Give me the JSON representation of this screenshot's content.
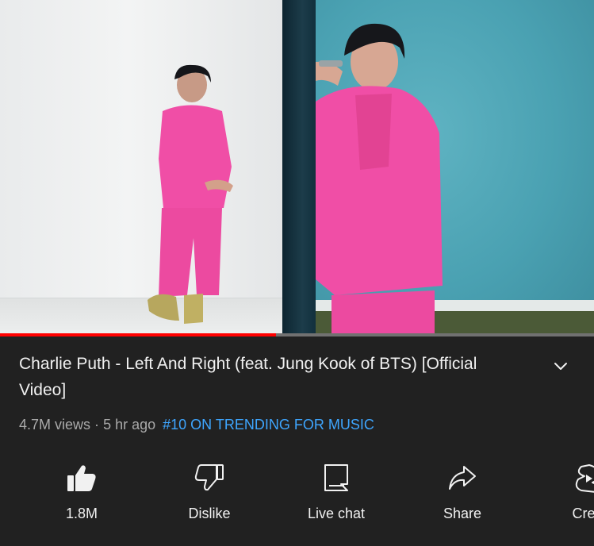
{
  "video": {
    "progress_percent": 46.5
  },
  "info": {
    "title": "Charlie Puth - Left And Right (feat. Jung Kook of BTS) [Official Video]",
    "views": "4.7M views",
    "separator": "·",
    "age": "5 hr ago",
    "trending": "#10 ON TRENDING FOR MUSIC"
  },
  "actions": {
    "like_label": "1.8M",
    "dislike_label": "Dislike",
    "live_chat_label": "Live chat",
    "share_label": "Share",
    "create_label": "Crea"
  },
  "colors": {
    "background": "#212121",
    "progress": "#ff0000",
    "trending": "#3ea6ff",
    "meta_text": "#aaaaaa"
  },
  "icons": [
    "thumbs-up-filled-icon",
    "thumbs-down-icon",
    "live-chat-icon",
    "share-icon",
    "create-icon",
    "chevron-down-icon"
  ]
}
